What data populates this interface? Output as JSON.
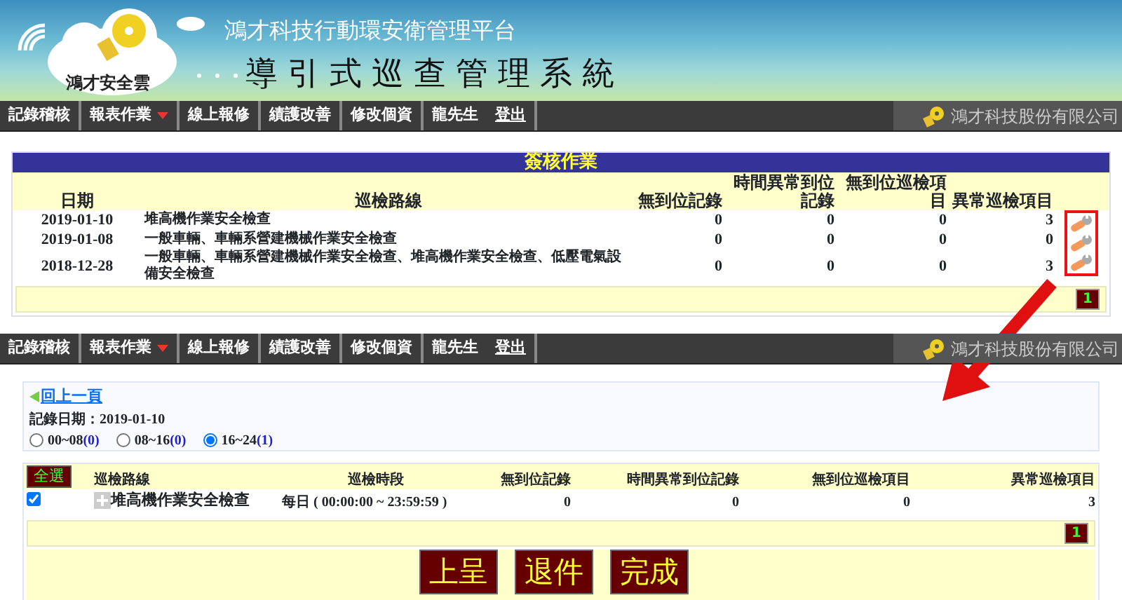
{
  "header": {
    "logo_text": "鴻才安全雲",
    "subtitle": "鴻才科技行動環安衛管理平台",
    "title": "導引式巡查管理系統"
  },
  "navbars": [
    {
      "items": [
        {
          "label": "記錄稽核",
          "dropdown": false
        },
        {
          "label": "報表作業",
          "dropdown": true
        },
        {
          "label": "線上報修",
          "dropdown": false
        },
        {
          "label": "績護改善",
          "dropdown": false
        },
        {
          "label": "修改個資",
          "dropdown": false
        }
      ],
      "user": "龍先生",
      "logout": "登出",
      "company": "鴻才科技股份有限公司"
    },
    {
      "items": [
        {
          "label": "記錄稽核",
          "dropdown": false
        },
        {
          "label": "報表作業",
          "dropdown": true
        },
        {
          "label": "線上報修",
          "dropdown": false
        },
        {
          "label": "績護改善",
          "dropdown": false
        },
        {
          "label": "修改個資",
          "dropdown": false
        }
      ],
      "user": "龍先生",
      "logout": "登出",
      "company": "鴻才科技股份有限公司"
    }
  ],
  "sign_table": {
    "title": "簽核作業",
    "columns": [
      "日期",
      "巡檢路線",
      "無到位記錄",
      "時間異常到位記錄",
      "無到位巡檢項目",
      "異常巡檢項目"
    ],
    "rows": [
      {
        "date": "2019-01-10",
        "route": "堆高機作業安全檢查",
        "values": [
          "0",
          "0",
          "0",
          "3"
        ]
      },
      {
        "date": "2019-01-08",
        "route": "一般車輛、車輛系營建機械作業安全檢查",
        "values": [
          "0",
          "0",
          "0",
          "0"
        ]
      },
      {
        "date": "2018-12-28",
        "route": "一般車輛、車輛系營建機械作業安全檢查、堆高機作業安全檢查、低壓電氣設備安全檢查",
        "values": [
          "0",
          "0",
          "0",
          "3"
        ]
      }
    ],
    "pager": "1"
  },
  "detail": {
    "back": "回上一頁",
    "record_date": "記錄日期：2019-01-10",
    "radios": [
      {
        "label": "00~08",
        "count": "(0)",
        "selected": false
      },
      {
        "label": "08~16",
        "count": "(0)",
        "selected": false
      },
      {
        "label": "16~24",
        "count": "(1)",
        "selected": true
      }
    ],
    "select_all": "全選",
    "columns": [
      "巡檢路線",
      "巡檢時段",
      "無到位記錄",
      "時間異常到位記錄",
      "無到位巡檢項目",
      "異常巡檢項目"
    ],
    "rows": [
      {
        "checked": true,
        "route": "堆高機作業安全檢查",
        "period": "每日 ( 00:00:00 ~ 23:59:59 )",
        "values": [
          "0",
          "0",
          "0",
          "3"
        ]
      }
    ],
    "pager": "1",
    "buttons": [
      "上呈",
      "退件",
      "完成"
    ]
  }
}
